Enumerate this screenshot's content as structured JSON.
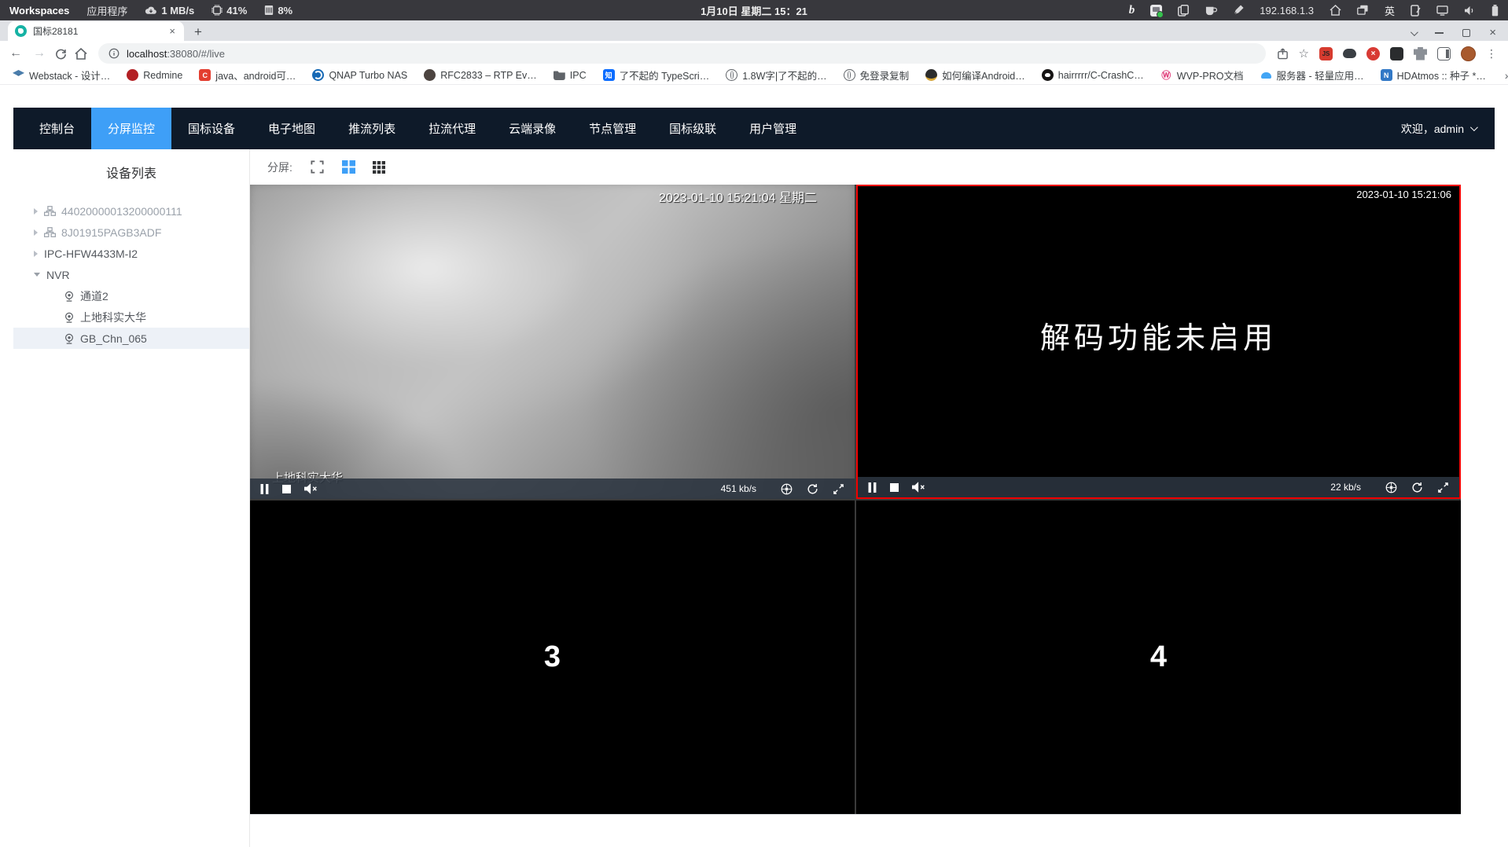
{
  "desktop_bar": {
    "workspaces_label": "Workspaces",
    "applications_label": "应用程序",
    "net_speed": "1 MB/s",
    "cpu_usage": "41%",
    "mem_usage": "8%",
    "clock": "1月10日 星期二 15：21",
    "bing_glyph": "b",
    "ip_address": "192.168.1.3",
    "ime_label": "英"
  },
  "browser": {
    "tab_title": "国标28181",
    "url": {
      "host": "localhost",
      "rest": ":38080/#/live"
    },
    "ext_js_badge": "JS",
    "bookmarks": [
      {
        "label": "Webstack - 设计…",
        "glyph": ""
      },
      {
        "label": "Redmine",
        "glyph": ""
      },
      {
        "label": "java、android可…",
        "glyph": "C"
      },
      {
        "label": "QNAP Turbo NAS",
        "glyph": ""
      },
      {
        "label": "RFC2833 – RTP Ev…",
        "glyph": ""
      },
      {
        "label": "IPC",
        "glyph": ""
      },
      {
        "label": "了不起的 TypeScri…",
        "glyph": "知"
      },
      {
        "label": "1.8W字|了不起的…",
        "glyph": ""
      },
      {
        "label": "免登录复制",
        "glyph": ""
      },
      {
        "label": "如何编译Android…",
        "glyph": ""
      },
      {
        "label": "hairrrrr/C-CrashC…",
        "glyph": ""
      },
      {
        "label": "WVP-PRO文档",
        "glyph": "Ⓦ"
      },
      {
        "label": "服务器 - 轻量应用…",
        "glyph": ""
      },
      {
        "label": "HDAtmos :: 种子 *…",
        "glyph": "N"
      }
    ],
    "bookmarks_overflow": "»"
  },
  "app": {
    "nav": [
      "控制台",
      "分屏监控",
      "国标设备",
      "电子地图",
      "推流列表",
      "拉流代理",
      "云端录像",
      "节点管理",
      "国标级联",
      "用户管理"
    ],
    "welcome": "欢迎，admin",
    "sidebar": {
      "title": "设备列表",
      "items": [
        {
          "label": "44020000013200000111"
        },
        {
          "label": "8J01915PAGB3ADF"
        },
        {
          "label": "IPC-HFW4433M-I2"
        },
        {
          "label": "NVR"
        },
        {
          "label": "通道2"
        },
        {
          "label": "上地科实大华"
        },
        {
          "label": "GB_Chn_065"
        }
      ]
    },
    "toolbar": {
      "split_label": "分屏:"
    },
    "videos": [
      {
        "timestamp": "2023-01-10 15:21:04 星期二",
        "name": "上地科实大华",
        "bitrate": "451 kb/s"
      },
      {
        "timestamp": "2023-01-10 15:21:06",
        "message": "解码功能未启用",
        "bitrate": "22 kb/s"
      },
      {
        "label": "3"
      },
      {
        "label": "4"
      }
    ],
    "colors": {
      "accent_blue": "#3e9ff7",
      "selected_border_red": "#f20000",
      "nav_dark": "#0e1a29"
    }
  }
}
